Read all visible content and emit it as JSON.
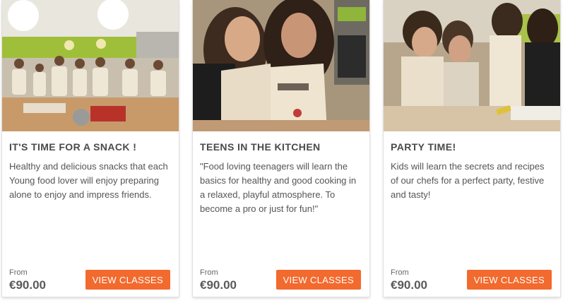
{
  "cards": [
    {
      "image_alt": "Kids preparing snacks at a kitchen counter",
      "title": "IT'S TIME FOR A SNACK !",
      "description": "Healthy and delicious snacks that each Young food lover will enjoy preparing alone to enjoy and impress friends.",
      "from_label": "From",
      "price": "€90.00",
      "button_label": "VIEW CLASSES"
    },
    {
      "image_alt": "Two teenage girls cooking in aprons",
      "title": "TEENS IN THE KITCHEN",
      "description": "\"Food loving teenagers will learn the basics for healthy and good cooking in a relaxed, playful atmosphere. To become a pro or just for fun!\"",
      "from_label": "From",
      "price": "€90.00",
      "button_label": "VIEW CLASSES"
    },
    {
      "image_alt": "Children baking together at a party",
      "title": "PARTY TIME!",
      "description": "Kids will learn the secrets and recipes of our chefs for a perfect party, festive and tasty!",
      "from_label": "From",
      "price": "€90.00",
      "button_label": "VIEW CLASSES"
    }
  ],
  "colors": {
    "accent": "#f26a2e",
    "title": "#4a4a4a",
    "text": "#555555"
  }
}
